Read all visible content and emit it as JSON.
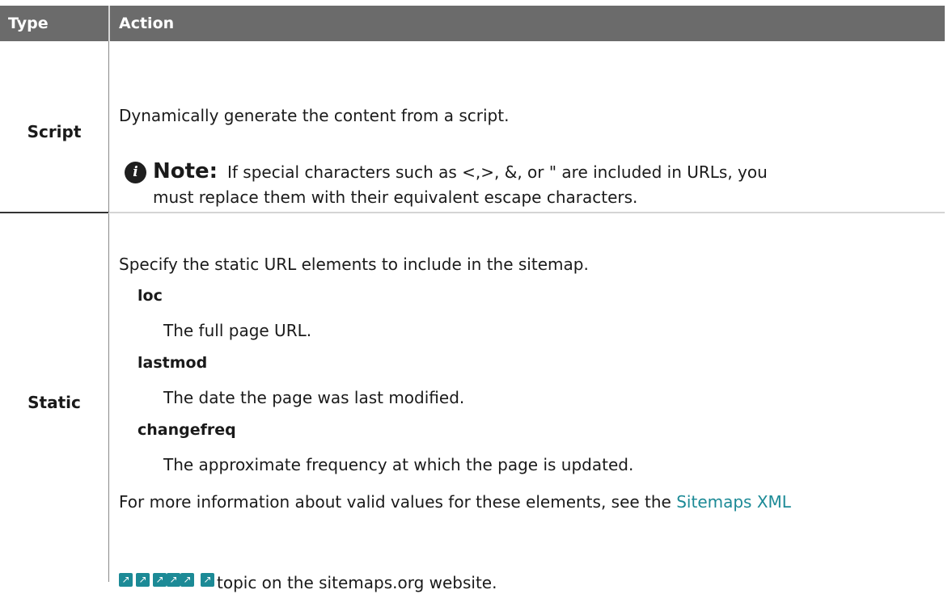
{
  "table": {
    "headers": {
      "type": "Type",
      "action": "Action"
    },
    "script_row": {
      "type": "Script",
      "description": "Dynamically generate the content from a script.",
      "note_label": "Note:",
      "note_line1": "If special characters such as <,>, &, or \" are included in URLs, you",
      "note_line2": "must replace them with their equivalent escape characters."
    },
    "static_row": {
      "type": "Static",
      "description": "Specify the static URL elements to include in the sitemap.",
      "elements": [
        {
          "term": "loc",
          "definition": "The full page URL."
        },
        {
          "term": "lastmod",
          "definition": "The date the page was last modified."
        },
        {
          "term": "changefreq",
          "definition": "The approximate frequency at which the page is updated."
        }
      ],
      "more_info_prefix": "For more information about valid values for these elements, see the ",
      "link_text": "Sitemaps XML",
      "more_info_suffix": "topic on the sitemaps.org website."
    }
  },
  "icons": {
    "note": "info-icon",
    "external": "external-link-icon",
    "external_glyph": "↗",
    "note_glyph": "i"
  },
  "colors": {
    "header_bg": "#6b6b6b",
    "link": "#1c8a96"
  }
}
